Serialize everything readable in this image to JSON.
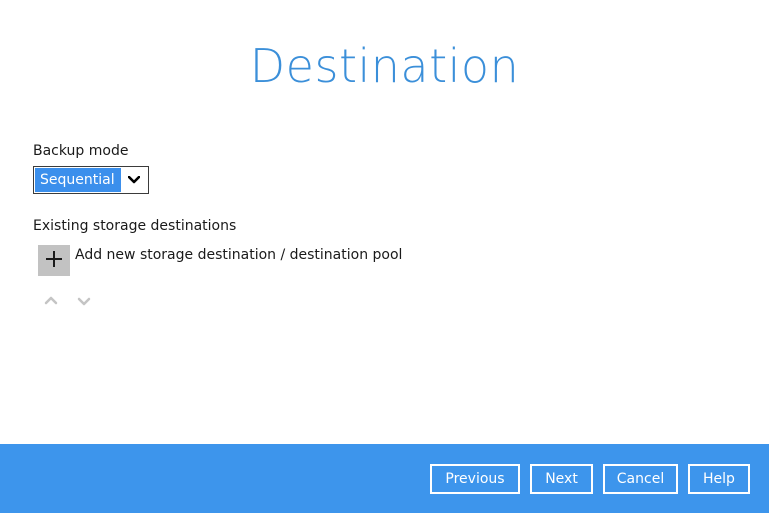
{
  "page": {
    "title": "Destination"
  },
  "backup_mode": {
    "label": "Backup mode",
    "selected": "Sequential"
  },
  "destinations": {
    "label": "Existing storage destinations",
    "add_label": "Add new storage destination / destination pool"
  },
  "footer": {
    "previous": "Previous",
    "next": "Next",
    "cancel": "Cancel",
    "help": "Help"
  },
  "colors": {
    "accent": "#3b8fd9",
    "footer_bg": "#3d95ec",
    "select_highlight": "#3b8fec",
    "add_button_bg": "#c2c2c2"
  },
  "icons": {
    "select_arrow": "chevron-down-icon",
    "add": "plus-icon",
    "move_up": "chevron-up-icon",
    "move_down": "chevron-down-icon"
  }
}
